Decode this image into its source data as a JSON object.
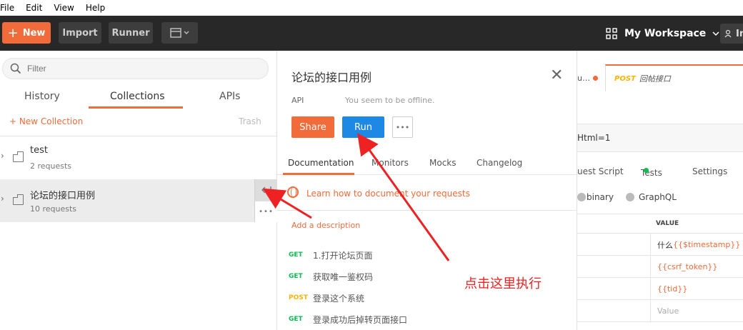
{
  "menu": [
    "File",
    "Edit",
    "View",
    "Help"
  ],
  "toolbar": {
    "new_label": "New",
    "import_label": "Import",
    "runner_label": "Runner",
    "workspace_label": "My Workspace",
    "user_initial": "In"
  },
  "sidebar": {
    "filter_placeholder": "Filter",
    "tabs": [
      "History",
      "Collections",
      "APIs"
    ],
    "active_tab": "Collections",
    "new_collection_label": "+ New Collection",
    "trash_label": "Trash",
    "collections": [
      {
        "name": "test",
        "count": "2 requests"
      },
      {
        "name": "论坛的接口用例",
        "count": "10 requests"
      }
    ]
  },
  "popup": {
    "title": "论坛的接口用例",
    "api_label": "API",
    "offline_text": "You seem to be offline.",
    "share_label": "Share",
    "run_label": "Run",
    "more_label": "•••",
    "tabs": [
      "Documentation",
      "Monitors",
      "Mocks",
      "Changelog"
    ],
    "active_tab": "Documentation",
    "learn_link": "Learn how to document your requests",
    "add_description": "Add a description",
    "requests": [
      {
        "method": "GET",
        "name": "1.打开论坛页面"
      },
      {
        "method": "GET",
        "name": "获取唯一鉴权码"
      },
      {
        "method": "POST",
        "name": "登录这个系统"
      },
      {
        "method": "GET",
        "name": "登录成功后掉转页面接口"
      }
    ]
  },
  "main": {
    "tab1_label": "u…",
    "tab2_method": "POST",
    "tab2_name": "回帖接口",
    "url_fragment": "Html=1",
    "req_tabs": [
      "uest Script",
      "Tests",
      "Settings"
    ],
    "body_options": [
      "binary",
      "GraphQL"
    ],
    "value_header": "VALUE",
    "values": [
      {
        "prefix": "什么",
        "var": "{{$timestamp}}"
      },
      {
        "prefix": "",
        "var": "{{csrf_token}}"
      },
      {
        "prefix": "",
        "var": "{{tid}}"
      },
      {
        "prefix": "",
        "var": "",
        "placeholder": "Value"
      }
    ]
  },
  "annotation": "点击这里执行",
  "colors": {
    "accent": "#f26b3a",
    "run_blue": "#1e88e5",
    "get_green": "#0cbb52",
    "post_yellow": "#ffb400",
    "arrow_red": "#ee2222"
  }
}
